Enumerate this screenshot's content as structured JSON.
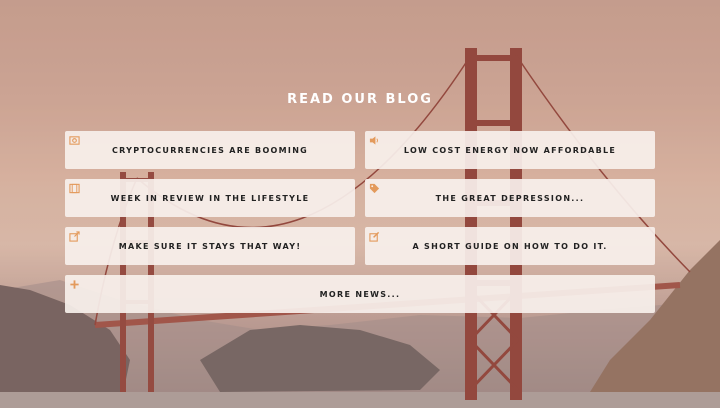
{
  "section": {
    "title": "READ OUR BLOG"
  },
  "posts": [
    {
      "title": "CRYPTOCURRENCIES ARE BOOMING",
      "icon": "image-icon"
    },
    {
      "title": "LOW COST ENERGY NOW AFFORDABLE",
      "icon": "volume-icon"
    },
    {
      "title": "WEEK IN REVIEW IN THE LIFESTYLE",
      "icon": "film-icon"
    },
    {
      "title": "THE GREAT DEPRESSION...",
      "icon": "tags-icon"
    },
    {
      "title": "MAKE SURE IT STAYS THAT WAY!",
      "icon": "external-link-icon"
    },
    {
      "title": "A SHORT GUIDE ON HOW TO DO IT.",
      "icon": "edit-icon"
    }
  ],
  "more": {
    "title": "MORE NEWS...",
    "icon": "plus-icon"
  },
  "colors": {
    "accent": "#e39a5c",
    "card": "#f7f0ec",
    "heading": "#ffffff"
  }
}
